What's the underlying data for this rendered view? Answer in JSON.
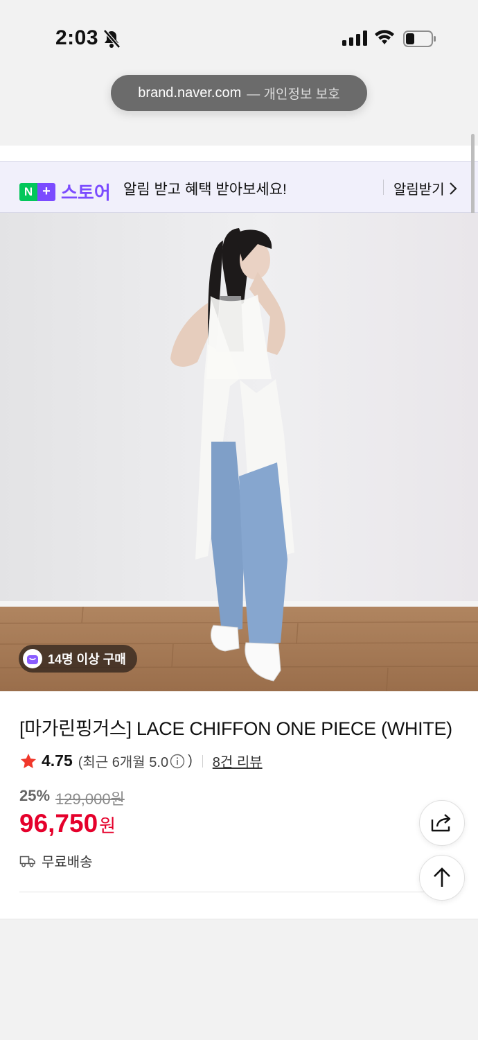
{
  "status_bar": {
    "time": "2:03"
  },
  "browser": {
    "url": "brand.naver.com",
    "privacy": "— 개인정보 보호"
  },
  "promo": {
    "logo_n": "N",
    "logo_plus": "+",
    "logo_store": "스토어",
    "message": "알림 받고 혜택 받아보세요!",
    "button": "알림받기"
  },
  "product": {
    "buyers_badge": "14명 이상 구매",
    "title": "[마가린핑거스] LACE CHIFFON ONE PIECE (WHITE)",
    "rating": "4.75",
    "recent_rating": "(최근 6개월 5.0",
    "recent_rating_close": ")",
    "reviews": "8건 리뷰",
    "discount": "25%",
    "original_price": "129,000원",
    "price": "96,750",
    "price_unit": "원",
    "shipping": "무료배송"
  },
  "colors": {
    "accent": "#7b4bff",
    "price": "#e5002b",
    "naver_green": "#03c75a"
  },
  "icons": [
    "bell-slash-icon",
    "signal-icon",
    "wifi-icon",
    "battery-icon",
    "chevron-right-icon",
    "bag-icon",
    "star-icon",
    "info-icon",
    "truck-icon",
    "share-icon",
    "arrow-up-icon"
  ]
}
